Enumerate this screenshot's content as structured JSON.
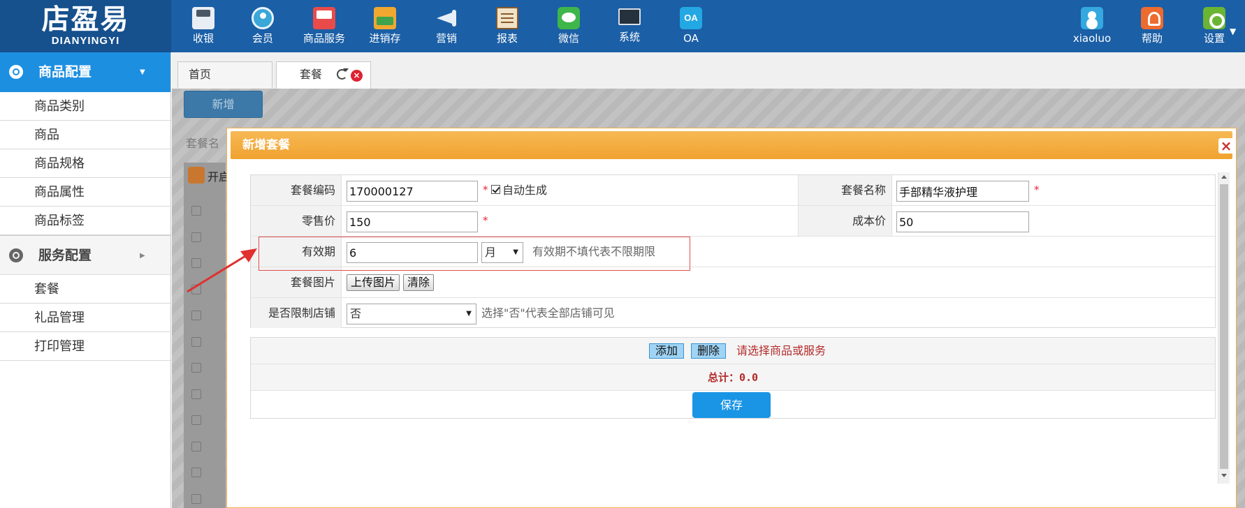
{
  "logo": {
    "cn": "店盈易",
    "en": "DIANYINGYI"
  },
  "nav": [
    {
      "label": "收银",
      "icon": "cash-register-icon"
    },
    {
      "label": "会员",
      "icon": "member-icon"
    },
    {
      "label": "商品服务",
      "icon": "goods-service-icon"
    },
    {
      "label": "进销存",
      "icon": "inventory-icon"
    },
    {
      "label": "营销",
      "icon": "megaphone-icon"
    },
    {
      "label": "报表",
      "icon": "report-icon"
    },
    {
      "label": "微信",
      "icon": "wechat-icon"
    },
    {
      "label": "系统",
      "icon": "monitor-icon"
    },
    {
      "label": "OA",
      "icon": "oa-icon",
      "icon_text": "OA"
    }
  ],
  "user": {
    "name": "xiaoluo",
    "help": "帮助",
    "settings": "设置"
  },
  "sidebar": {
    "sections": [
      {
        "title": "商品配置",
        "items": [
          "商品类别",
          "商品",
          "商品规格",
          "商品属性",
          "商品标签"
        ]
      },
      {
        "title": "服务配置",
        "items": [
          "套餐",
          "礼品管理",
          "打印管理"
        ]
      }
    ]
  },
  "tabs": {
    "home": "首页",
    "current": "套餐"
  },
  "background": {
    "add_button": "新增",
    "search_label": "套餐名",
    "open_label": "开启"
  },
  "dialog": {
    "title": "新增套餐",
    "fields": {
      "code_label": "套餐编码",
      "code_value": "170000127",
      "auto_gen_label": "自动生成",
      "name_label": "套餐名称",
      "name_value": "手部精华液护理",
      "retail_label": "零售价",
      "retail_value": "150",
      "cost_label": "成本价",
      "cost_value": "50",
      "validity_label": "有效期",
      "validity_value": "6",
      "validity_unit": "月",
      "validity_hint": "有效期不填代表不限期限",
      "image_label": "套餐图片",
      "upload_button": "上传图片",
      "clear_button": "清除",
      "limit_label": "是否限制店铺",
      "limit_value": "否",
      "limit_hint": "选择\"否\"代表全部店铺可见",
      "required_mark": "*"
    },
    "goods": {
      "add_button": "添加",
      "delete_button": "删除",
      "hint": "请选择商品或服务",
      "total": "总计：0.0"
    },
    "save_button": "保存"
  },
  "colors": {
    "topbar": "#1b5fa6",
    "accent_blue": "#1d8fe1",
    "dialog_header": "#f0a22f",
    "required": "#e22233",
    "highlight": "#e05050"
  }
}
